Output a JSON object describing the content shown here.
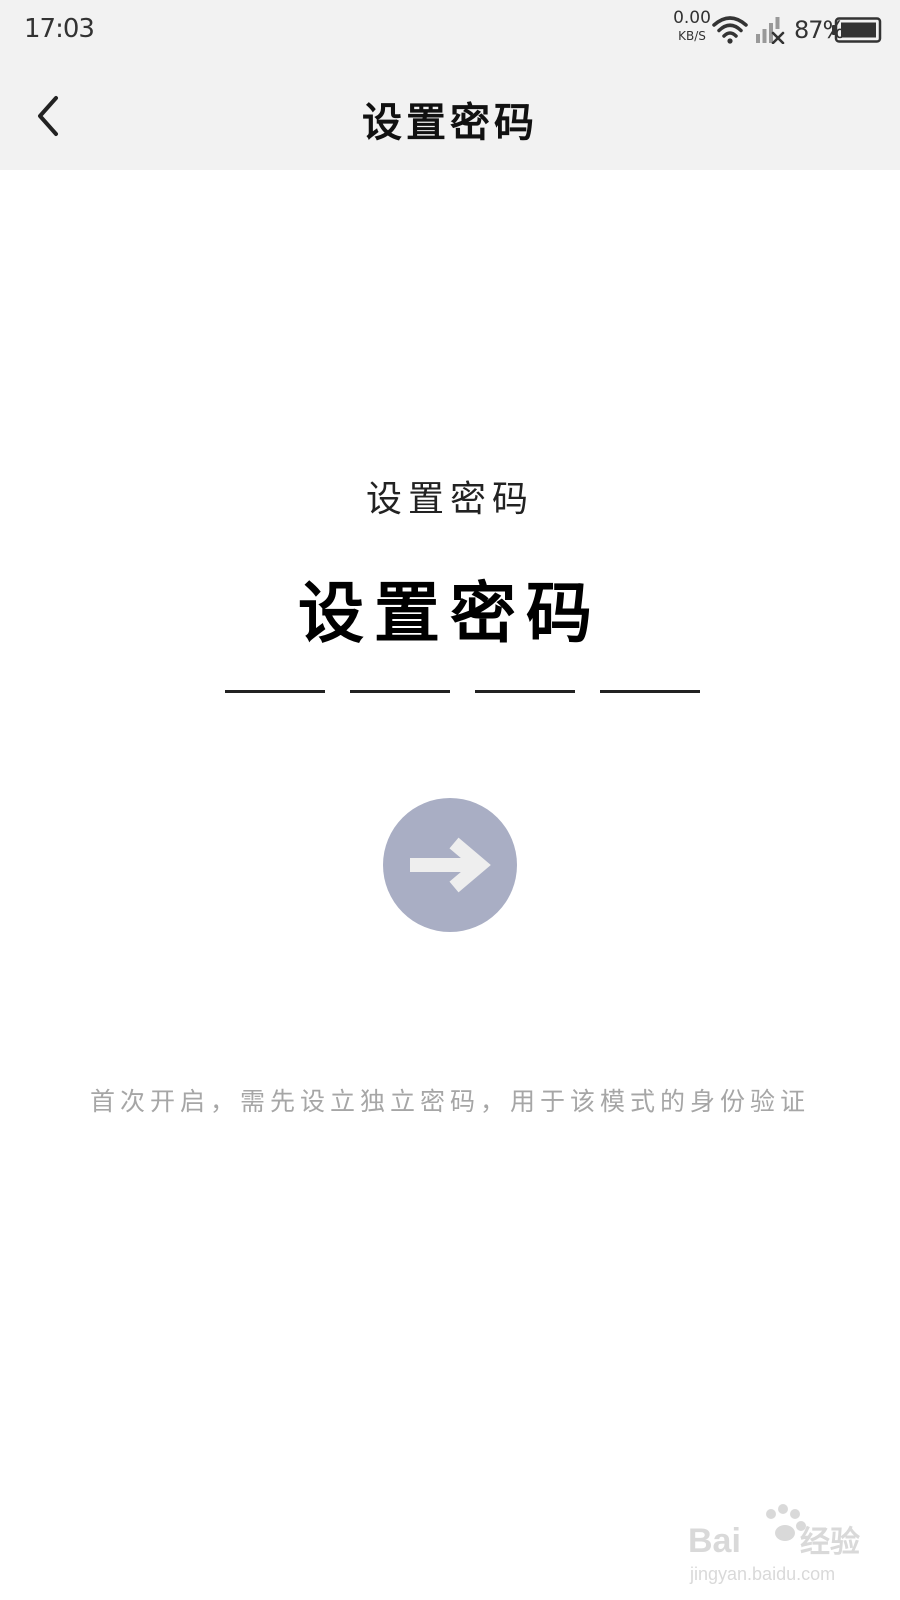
{
  "status_bar": {
    "time": "17:03",
    "net_speed_value": "0.00",
    "net_speed_unit": "KB/S",
    "battery_percent": "87%",
    "icons": [
      "wifi-icon",
      "signal-icon",
      "battery-icon"
    ]
  },
  "nav": {
    "title": "设置密码",
    "back_icon": "chevron-left-icon"
  },
  "content": {
    "subtitle": "设置密码",
    "title": "设置密码",
    "pin_length": 4,
    "next_icon": "arrow-right-icon",
    "hint": "首次开启，需先设立独立密码，用于该模式的身份验证"
  },
  "colors": {
    "bar_background": "#f2f2f2",
    "button_fill": "#a9aec4",
    "hint_text": "#a6a6a6"
  },
  "watermark": {
    "brand": "Baidu经验",
    "url": "jingyan.baidu.com"
  }
}
